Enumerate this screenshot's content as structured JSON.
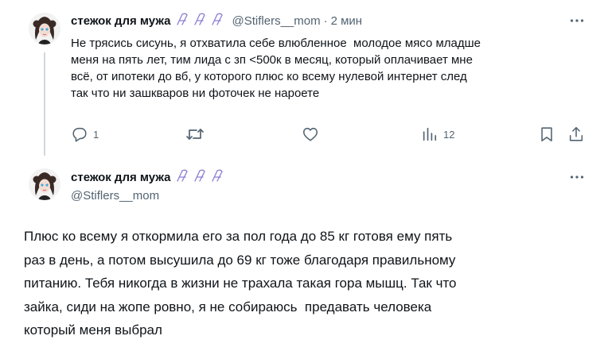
{
  "tweet1": {
    "display_name": "стежок для мужа",
    "handle": "@Stiflers__mom",
    "separator": "·",
    "time": "2 мин",
    "text": "Не трясись сисунь, я отхватила себе влюбленное  молодое мясо младше\nменя на пять лет, тим лида с зп <500к в месяц, который оплачивает мне\nвсё, от ипотеки до вб, у которого плюс ко всему нулевой интернет след\nтак что ни зашкваров ни фоточек не нароете",
    "replies": "1",
    "views": "12",
    "icons": [
      "more-icon",
      "reply-icon",
      "retweet-icon",
      "like-icon",
      "views-icon",
      "bookmark-icon",
      "share-icon"
    ]
  },
  "tweet2": {
    "display_name": "стежок для мужа",
    "handle": "@Stiflers__mom",
    "text": "Плюс ко всему я откормила его за пол года до 85 кг готовя ему пять\nраз в день, а потом высушила до 69 кг тоже благодаря правильному\nпитанию. Тебя никогда в жизни не трахала такая гора мышц. Так что\nзайка, сиди на жопе ровно, я не собираюсь  предавать человека\nкоторый меня выбрал"
  },
  "colors": {
    "text": "#0f1419",
    "secondary": "#536471",
    "thread_line": "#cfd9de",
    "deco_purple": "#8b7fd4"
  }
}
